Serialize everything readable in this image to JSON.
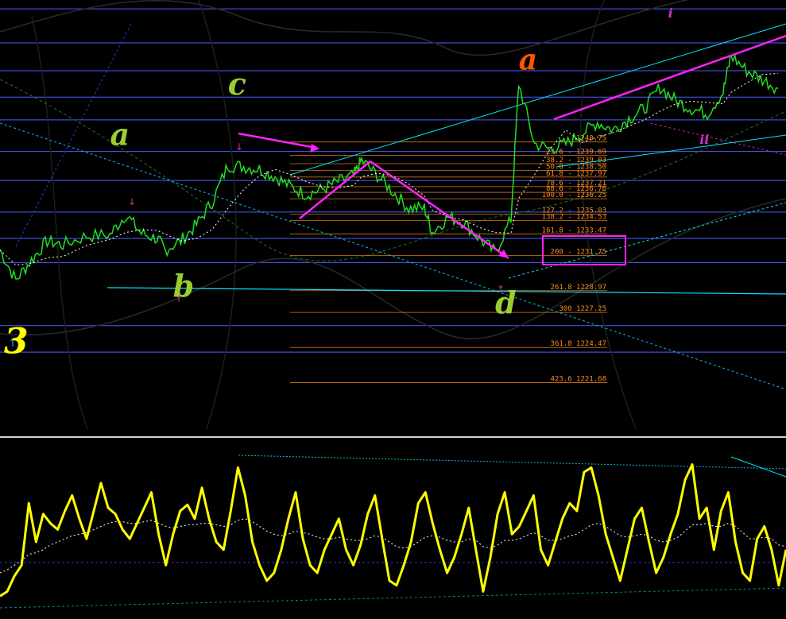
{
  "chart_data": [
    {
      "type": "line",
      "panel": "price",
      "title": "",
      "xlabel": "",
      "ylabel": "",
      "ylim": [
        1218,
        1252
      ],
      "grid": false,
      "colors": {
        "price": "#22dd22",
        "trend": "#00e5ff",
        "wave": "#ff22ff",
        "fib": "#ff8c1a",
        "hline": "#4a5cff"
      },
      "price_series": [
        {
          "t": 0,
          "v": 1232.2
        },
        {
          "t": 2,
          "v": 1229.8
        },
        {
          "t": 4,
          "v": 1231.4
        },
        {
          "t": 6,
          "v": 1232.9
        },
        {
          "t": 8,
          "v": 1232.6
        },
        {
          "t": 11,
          "v": 1233.3
        },
        {
          "t": 14,
          "v": 1233.4
        },
        {
          "t": 16,
          "v": 1235.0
        },
        {
          "t": 18,
          "v": 1233.5
        },
        {
          "t": 20,
          "v": 1233.1
        },
        {
          "t": 21,
          "v": 1232.2
        },
        {
          "t": 23,
          "v": 1232.9
        },
        {
          "t": 25,
          "v": 1234.2
        },
        {
          "t": 27,
          "v": 1236.0
        },
        {
          "t": 29,
          "v": 1238.9
        },
        {
          "t": 31,
          "v": 1238.8
        },
        {
          "t": 33,
          "v": 1238.6
        },
        {
          "t": 35,
          "v": 1238.0
        },
        {
          "t": 37,
          "v": 1237.2
        },
        {
          "t": 39,
          "v": 1236.6
        },
        {
          "t": 41,
          "v": 1237.0
        },
        {
          "t": 43,
          "v": 1237.6
        },
        {
          "t": 45,
          "v": 1238.1
        },
        {
          "t": 46,
          "v": 1239.3
        },
        {
          "t": 48,
          "v": 1238.1
        },
        {
          "t": 50,
          "v": 1236.8
        },
        {
          "t": 52,
          "v": 1235.5
        },
        {
          "t": 54,
          "v": 1235.5
        },
        {
          "t": 55,
          "v": 1233.6
        },
        {
          "t": 57,
          "v": 1234.8
        },
        {
          "t": 59,
          "v": 1234.4
        },
        {
          "t": 61,
          "v": 1233.1
        },
        {
          "t": 63,
          "v": 1232.0
        },
        {
          "t": 65,
          "v": 1234.6
        },
        {
          "t": 66,
          "v": 1245.4
        },
        {
          "t": 68,
          "v": 1240.6
        },
        {
          "t": 70,
          "v": 1240.2
        },
        {
          "t": 72,
          "v": 1240.6
        },
        {
          "t": 74,
          "v": 1241.4
        },
        {
          "t": 76,
          "v": 1242.3
        },
        {
          "t": 78,
          "v": 1241.7
        },
        {
          "t": 80,
          "v": 1242.6
        },
        {
          "t": 82,
          "v": 1243.4
        },
        {
          "t": 84,
          "v": 1245.1
        },
        {
          "t": 86,
          "v": 1244.0
        },
        {
          "t": 88,
          "v": 1243.4
        },
        {
          "t": 90,
          "v": 1243.0
        },
        {
          "t": 92,
          "v": 1244.7
        },
        {
          "t": 93,
          "v": 1247.6
        },
        {
          "t": 95,
          "v": 1246.4
        },
        {
          "t": 97,
          "v": 1245.7
        },
        {
          "t": 99,
          "v": 1245.0
        }
      ],
      "fib_levels": [
        {
          "ratio": "",
          "price": "1240.75",
          "label": "1240.75"
        },
        {
          "ratio": "23.6",
          "price": "1239.69",
          "label": "23.6 - 1239.69"
        },
        {
          "ratio": "38.2",
          "price": "1239.03",
          "label": "38.2 - 1239.03"
        },
        {
          "ratio": "50.0",
          "price": "1238.50",
          "label": "50.0 - 1238.50"
        },
        {
          "ratio": "61.8",
          "price": "1237.97",
          "label": "61.8 - 1237.97"
        },
        {
          "ratio": "78.6",
          "price": "1237.21",
          "label": "78.6 - 1237.21"
        },
        {
          "ratio": "88.6",
          "price": "1236.76",
          "label": "88.6 - 1236.76"
        },
        {
          "ratio": "100.0",
          "price": "1236.25",
          "label": "100.0 - 1236.25"
        },
        {
          "ratio": "127.2",
          "price": "1235.03",
          "label": "127.2 - 1235.03"
        },
        {
          "ratio": "138.2",
          "price": "1234.53",
          "label": "138.2 - 1234.53"
        },
        {
          "ratio": "161.8",
          "price": "1233.47",
          "label": "161.8 - 1233.47"
        },
        {
          "ratio": "200",
          "price": "1231.75",
          "label": "200 - 1231.75"
        },
        {
          "ratio": "261.8",
          "price": "1228.97",
          "label": "261.8 1228.97"
        },
        {
          "ratio": "300",
          "price": "1227.25",
          "label": "300 1227.25"
        },
        {
          "ratio": "361.8",
          "price": "1224.47",
          "label": "361.8 1224.47"
        },
        {
          "ratio": "423.6",
          "price": "1221.68",
          "label": "423.6 1221.68"
        }
      ],
      "highlighted_level": "161.8",
      "horizontal_levels": [
        1251.3,
        1248.6,
        1246.4,
        1244.3,
        1242.5,
        1240.0,
        1237.7,
        1235.2,
        1233.1,
        1231.2,
        1226.2,
        1224.1
      ],
      "wave_labels": [
        {
          "text": "3",
          "t": 0.5,
          "v": 1224.0,
          "color": "#ffff00",
          "size": 44
        },
        {
          "text": "a",
          "t": 14,
          "v": 1240.5,
          "color": "#9acd32",
          "size": 38
        },
        {
          "text": "b",
          "t": 22,
          "v": 1228.5,
          "color": "#9acd32",
          "size": 38
        },
        {
          "text": "c",
          "t": 29,
          "v": 1244.5,
          "color": "#9acd32",
          "size": 38
        },
        {
          "text": "a",
          "t": 66,
          "v": 1246.5,
          "color": "#ff5500",
          "size": 36
        },
        {
          "text": "d",
          "t": 63,
          "v": 1227.2,
          "color": "#9acd32",
          "size": 38
        },
        {
          "text": "i",
          "t": 85,
          "v": 1250.6,
          "color": "#cc33cc",
          "size": 16
        },
        {
          "text": "ii",
          "t": 89,
          "v": 1240.6,
          "color": "#cc33cc",
          "size": 16
        }
      ]
    },
    {
      "type": "line",
      "panel": "oscillator",
      "title": "",
      "ylim": [
        0,
        100
      ],
      "colors": {
        "osc": "#ffff00",
        "signal": "#ffffff"
      },
      "series": [
        {
          "values": [
            5,
            8,
            18,
            25,
            65,
            40,
            58,
            52,
            48,
            60,
            70,
            55,
            42,
            60,
            78,
            62,
            58,
            48,
            42,
            52,
            62,
            72,
            45,
            25,
            45,
            60,
            64,
            55,
            75,
            55,
            40,
            35,
            60,
            88,
            70,
            40,
            25,
            15,
            20,
            35,
            55,
            72,
            42,
            25,
            20,
            35,
            45,
            55,
            35,
            25,
            38,
            58,
            70,
            42,
            15,
            12,
            25,
            40,
            65,
            72,
            52,
            35,
            20,
            30,
            45,
            62,
            35,
            8,
            30,
            58,
            72,
            45,
            50,
            60,
            70,
            35,
            25,
            40,
            55,
            65,
            60,
            85,
            88,
            70,
            45,
            30,
            15,
            35,
            55,
            62,
            40,
            20,
            30,
            45,
            58,
            80,
            90,
            55,
            62,
            35,
            60,
            72,
            40,
            20,
            15,
            42,
            50,
            35,
            12,
            35
          ]
        },
        {
          "values": [
            20,
            22,
            25,
            28,
            32,
            33,
            35,
            38,
            40,
            42,
            44,
            45,
            46,
            48,
            50,
            52,
            53,
            53,
            52,
            52,
            53,
            54,
            52,
            50,
            49,
            50,
            51,
            51,
            52,
            52,
            51,
            50,
            51,
            54,
            55,
            53,
            50,
            47,
            45,
            44,
            45,
            47,
            46,
            45,
            43,
            42,
            42,
            43,
            42,
            41,
            41,
            42,
            44,
            43,
            40,
            37,
            36,
            37,
            40,
            43,
            44,
            43,
            41,
            40,
            40,
            42,
            41,
            37,
            36,
            38,
            41,
            41,
            42,
            44,
            46,
            44,
            41,
            41,
            42,
            44,
            45,
            48,
            51,
            52,
            50,
            47,
            44,
            43,
            44,
            45,
            44,
            41,
            40,
            41,
            43,
            47,
            51,
            51,
            52,
            50,
            50,
            52,
            50,
            46,
            42,
            42,
            43,
            42,
            38,
            37
          ]
        }
      ]
    }
  ]
}
